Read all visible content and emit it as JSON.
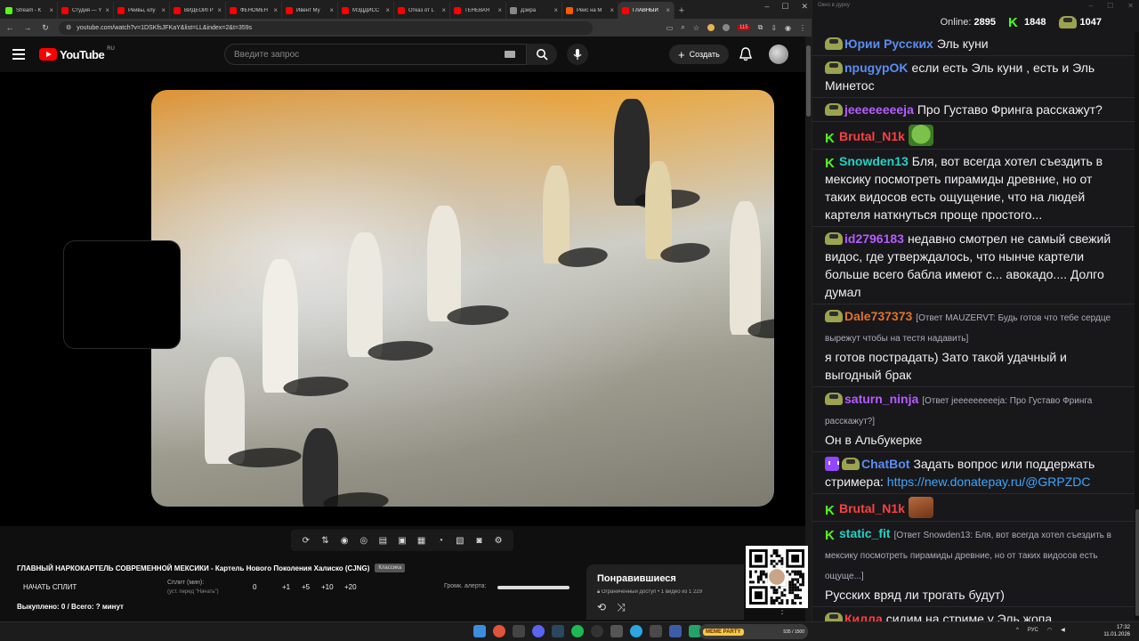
{
  "browser": {
    "tabs": [
      {
        "label": "Stream - К",
        "color": "#53fc18"
      },
      {
        "label": "Студия — Y",
        "color": "#ff0000"
      },
      {
        "label": "Рейвы, клу",
        "color": "#ff0000"
      },
      {
        "label": "ВИДЕОИГР",
        "color": "#ff0000"
      },
      {
        "label": "ФЕНОМЕН",
        "color": "#ff0000"
      },
      {
        "label": "Ивент Му",
        "color": "#ff0000"
      },
      {
        "label": "МЭДДИСС",
        "color": "#ff0000"
      },
      {
        "label": "Отказ от L",
        "color": "#ff0000"
      },
      {
        "label": "ТЕНЕВАЯ",
        "color": "#ff0000"
      },
      {
        "label": "Дзира",
        "color": "#888888"
      },
      {
        "label": "Рейс на М",
        "color": "#ff5a00"
      },
      {
        "label": "ГЛАВНЫЙ",
        "color": "#ff0000",
        "active": true
      }
    ],
    "url": "youtube.com/watch?v=1DSKfsJFKaY&list=LL&index=2&t=359s",
    "badge": "115"
  },
  "youtube": {
    "logo": "YouTube",
    "region": "RU",
    "search_placeholder": "Введите запрос",
    "create_label": "Создать",
    "video_title": "ГЛАВНЫЙ НАРКОКАРТЕЛЬ СОВРЕМЕННОЙ МЕКСИКИ - Картель Нового Поколения Халиско (CJNG)",
    "video_tag": "Классика",
    "split_button": "НАЧАТЬ СПЛИТ",
    "split_label": "Сплит (мин):",
    "split_hint": "(уст. перед \"Начать\")",
    "split_value": "0",
    "increments": [
      "+1",
      "+5",
      "+10",
      "+20"
    ],
    "volume_label": "Громк. алерта:",
    "bought_label": "Выкуплено: 0 / Всего: ? минут",
    "liked_title": "Понравившиеся",
    "liked_sub": "Ограниченный доступ • 1 видео из 1 229"
  },
  "chat": {
    "window_title": "Окно в дурку",
    "online_label": "Online:",
    "online_count": "2895",
    "kick_count": "1848",
    "pepe_count": "1047",
    "messages": [
      {
        "badge": "pepe",
        "nick": "Юрии Русских",
        "color": "#5b8def",
        "text": "Эль куни"
      },
      {
        "badge": "pepe",
        "nick": "npugypOK",
        "color": "#5b8def",
        "text": "если есть Эль куни , есть и Эль Минетос"
      },
      {
        "badge": "pepe",
        "nick": "jeeeeeeeeja",
        "color": "#b65cff",
        "text": "Про Густаво Фринга расскажут?"
      },
      {
        "badge": "k",
        "nick": "Brutal_N1k",
        "color": "#ff4040",
        "text": "",
        "emote": "pepe-emote"
      },
      {
        "badge": "k",
        "nick": "Snowden13",
        "color": "#22d3c5",
        "text": "Бля, вот всегда хотел съездить в мексику посмотреть пирамиды древние, но от таких видосов есть ощущение, что на людей картеля наткнуться проще простого..."
      },
      {
        "badge": "pepe",
        "nick": "id2796183",
        "color": "#b65cff",
        "text": "недавно смотрел не самый свежий видос, где утверждалось, что нынче картели больше всего бабла имеют с... авокадо.... Долго думал"
      },
      {
        "badge": "pepe",
        "nick": "Dale737373",
        "color": "#e0722f",
        "reply": "[Ответ MAUZERVT: Будь готов что тебе сердце вырежут чтобы на тестя надавить]",
        "text": "я готов пострадать) Зато такой удачный и выгодный брак"
      },
      {
        "badge": "pepe",
        "nick": "saturn_ninja",
        "color": "#b65cff",
        "reply": "[Ответ jeeeeeeeeeja: Про Густаво Фринга расскажут?]",
        "text": "Он в Альбукерке"
      },
      {
        "badge": "bot",
        "nick": "ChatBot",
        "color": "#5b8def",
        "text": "Задать вопрос или поддержать стримера:",
        "link": "https://new.donatepay.ru/@GRPZDC"
      },
      {
        "badge": "k",
        "nick": "Brutal_N1k",
        "color": "#ff4040",
        "text": "",
        "emote": "face-emote"
      },
      {
        "badge": "k",
        "nick": "static_fit",
        "color": "#22d3c5",
        "reply": "[Ответ Snowden13: Бля, вот всегда хотел съездить в мексику посмотреть пирамиды древние, но от таких видосов есть ощуще...]",
        "text": "Русских вряд ли трогать будут)"
      },
      {
        "badge": "pepe",
        "nick": "Килла",
        "color": "#ff4040",
        "text": "сидим на стриме у Эль жопа"
      }
    ]
  },
  "taskbar": {
    "widget_logo": "MEME PARTY",
    "widget_value": "535 / 1500",
    "lang": "РУС",
    "time": "17:32",
    "date": "11.01.2026"
  }
}
